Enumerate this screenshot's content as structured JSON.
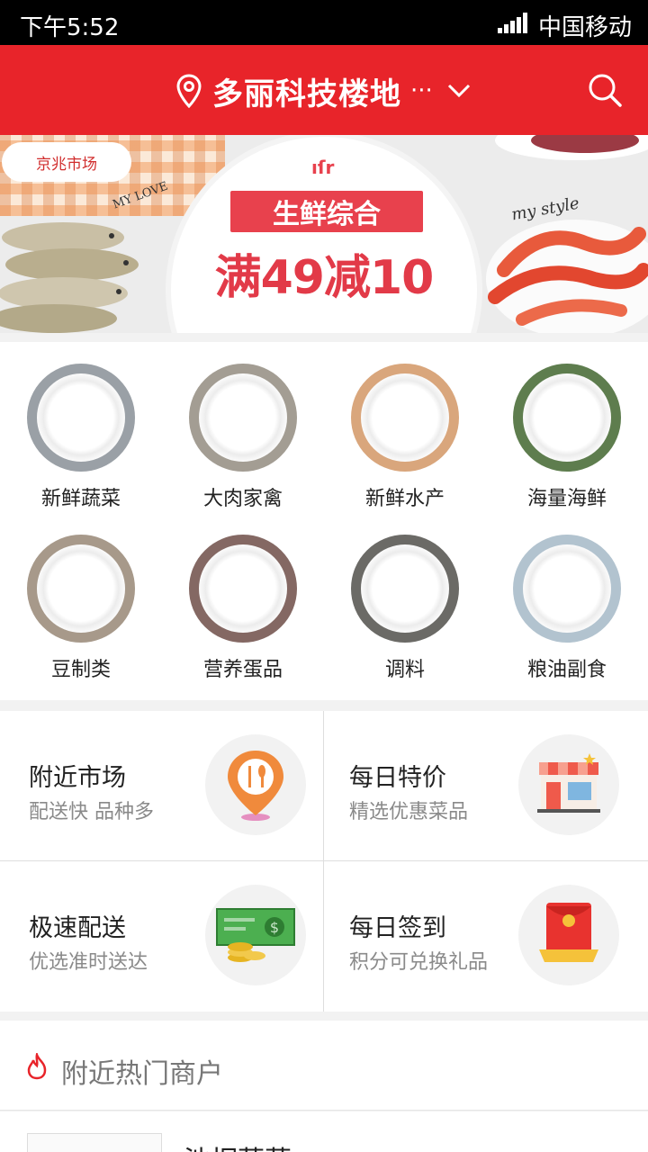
{
  "status_bar": {
    "time": "下午5:52",
    "carrier": "中国移动"
  },
  "header": {
    "location": "多丽科技楼地",
    "location_more": "···",
    "icons": [
      "location-pin-icon",
      "chevron-down-icon",
      "search-icon"
    ]
  },
  "banner": {
    "market_tag": "京兆市场",
    "category_label": "生鲜综合",
    "promo_text": "满49减10",
    "love_text": "MY LOVE",
    "style_text": "my style"
  },
  "categories": [
    {
      "label": "新鲜蔬菜",
      "ring_color": "#9aa0a6"
    },
    {
      "label": "大肉家禽",
      "ring_color": "#a39d93"
    },
    {
      "label": "新鲜水产",
      "ring_color": "#d9a67c"
    },
    {
      "label": "海量海鲜",
      "ring_color": "#5e7d4e"
    },
    {
      "label": "豆制类",
      "ring_color": "#a7998a"
    },
    {
      "label": "营养蛋品",
      "ring_color": "#846863"
    },
    {
      "label": "调料",
      "ring_color": "#6b6a66"
    },
    {
      "label": "粮油副食",
      "ring_color": "#b2c3cf"
    }
  ],
  "features": [
    {
      "title": "附近市场",
      "subtitle": "配送快 品种多",
      "icon": "market-location-icon"
    },
    {
      "title": "每日特价",
      "subtitle": "精选优惠菜品",
      "icon": "storefront-icon"
    },
    {
      "title": "极速配送",
      "subtitle": "优选准时送达",
      "icon": "cash-coins-icon"
    },
    {
      "title": "每日签到",
      "subtitle": "积分可兑换礼品",
      "icon": "red-envelope-icon"
    }
  ],
  "hot_section": {
    "title": "附近热门商户"
  },
  "merchant_preview": {
    "name": "池桐蔬菜"
  },
  "colors": {
    "brand_red": "#e8242a",
    "promo_red": "#e23a48"
  }
}
